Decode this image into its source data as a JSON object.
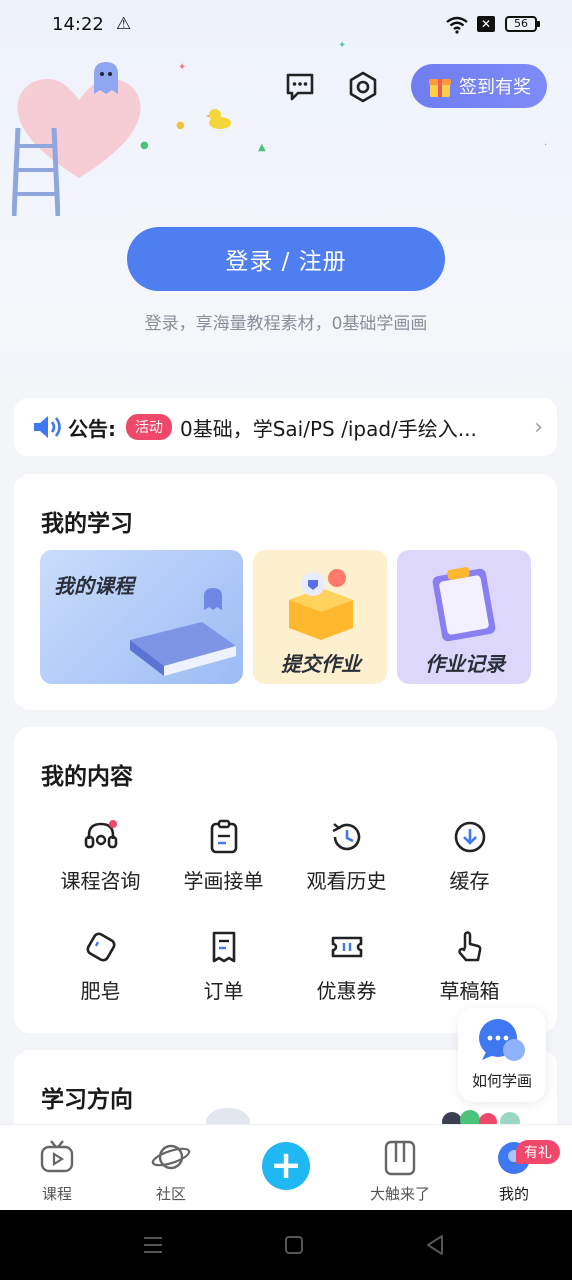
{
  "status_bar": {
    "time": "14:22",
    "battery": "56"
  },
  "header": {
    "checkin_label": "签到有奖"
  },
  "login": {
    "button_label": "登录 / 注册",
    "subtitle": "登录，享海量教程素材，0基础学画画"
  },
  "notice": {
    "label": "公告:",
    "tag": "活动",
    "text": "0基础，学Sai/PS /ipad/手绘入..."
  },
  "my_study": {
    "title": "我的学习",
    "tiles": [
      {
        "label": "我的课程"
      },
      {
        "label": "提交作业"
      },
      {
        "label": "作业记录"
      }
    ]
  },
  "my_content": {
    "title": "我的内容",
    "items": [
      {
        "label": "课程咨询",
        "icon": "headset-icon"
      },
      {
        "label": "学画接单",
        "icon": "clipboard-icon"
      },
      {
        "label": "观看历史",
        "icon": "history-icon"
      },
      {
        "label": "缓存",
        "icon": "download-icon"
      },
      {
        "label": "肥皂",
        "icon": "soap-icon"
      },
      {
        "label": "订单",
        "icon": "receipt-icon"
      },
      {
        "label": "优惠券",
        "icon": "coupon-icon"
      },
      {
        "label": "草稿箱",
        "icon": "hand-icon"
      }
    ]
  },
  "learning_direction": {
    "title": "学习方向"
  },
  "help_float": {
    "label": "如何学画"
  },
  "bottom_nav": {
    "items": [
      {
        "label": "课程"
      },
      {
        "label": "社区"
      },
      {
        "label": "大触来了"
      },
      {
        "label": "我的"
      }
    ],
    "badge": "有礼"
  },
  "colors": {
    "primary": "#4f7ef0",
    "checkin": "#7480f4",
    "tag": "#f0486a",
    "plus": "#1fb8f2"
  }
}
